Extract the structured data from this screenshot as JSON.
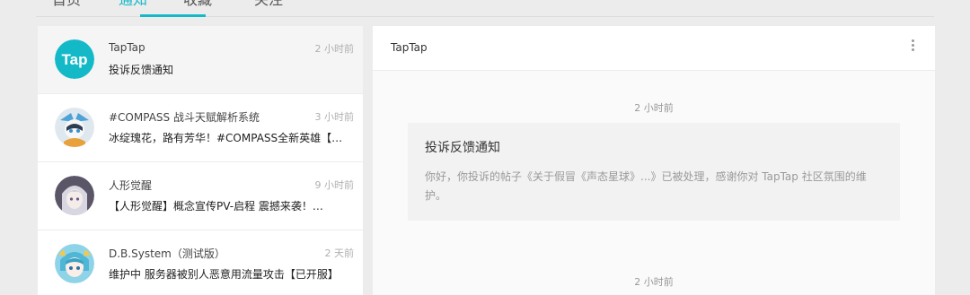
{
  "tabs": [
    {
      "label": "首页"
    },
    {
      "label": "通知"
    },
    {
      "label": "收藏"
    },
    {
      "label": "关注"
    }
  ],
  "conversations": [
    {
      "name": "TapTap",
      "time": "2 小时前",
      "preview": "投诉反馈通知",
      "avatar": "taptap-logo"
    },
    {
      "name": "#COMPASS 战斗天赋解析系统",
      "time": "3 小时前",
      "preview": "冰绽瑰花，路有芳华！#COMPASS全新英雄【…",
      "avatar": "game-avatar"
    },
    {
      "name": "人形觉醒",
      "time": "9 小时前",
      "preview": "【人形觉醒】概念宣传PV-启程 震撼来袭！…",
      "avatar": "game-avatar"
    },
    {
      "name": "D.B.System（测试版）",
      "time": "2 天前",
      "preview": "维护中 服务器被别人恶意用流量攻击【已开服】",
      "avatar": "game-avatar"
    }
  ],
  "chat": {
    "title": "TapTap",
    "messages": [
      {
        "time": "2 小时前",
        "title": "投诉反馈通知",
        "body": "你好，你投诉的帖子《关于假冒《声态星球》...》已被处理，感谢你对 TapTap 社区氛围的维护。"
      },
      {
        "time": "2 小时前"
      }
    ]
  },
  "colors": {
    "accent": "#14b9c8"
  },
  "logo": {
    "text": "Tap"
  }
}
